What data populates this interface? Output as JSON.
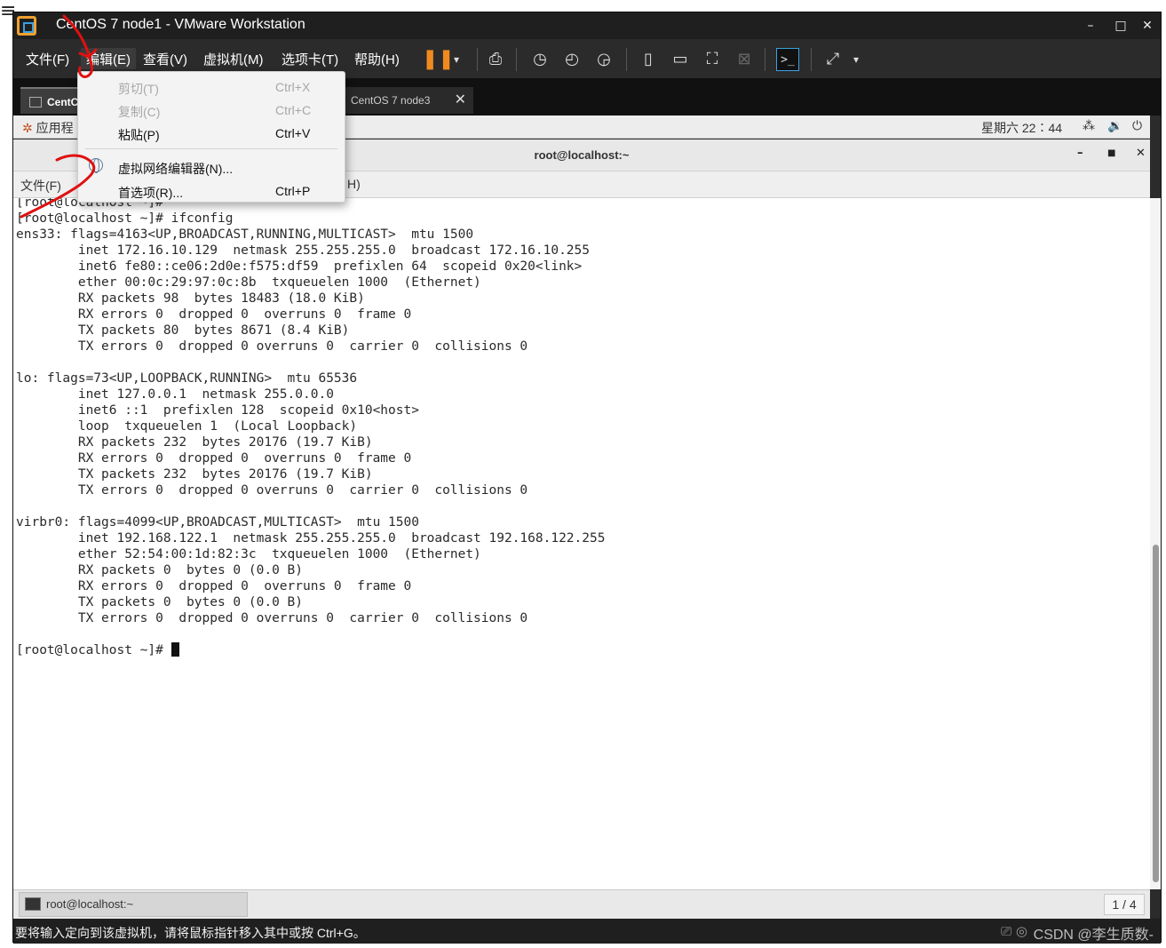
{
  "window": {
    "title": "CentOS 7 node1 - VMware Workstation",
    "controls": [
      "–",
      "□",
      "✕"
    ]
  },
  "menubar": {
    "items": [
      "文件(F)",
      "编辑(E)",
      "查看(V)",
      "虚拟机(M)",
      "选项卡(T)",
      "帮助(H)"
    ]
  },
  "toolbar_icons": [
    "pause-icon",
    "send-keys-icon",
    "snapshot-icon",
    "revert-snapshot-icon",
    "snapshot-manager-icon",
    "sidebar-icon",
    "thumbnail-bar-icon",
    "fullscreen-icon",
    "unity-icon",
    "console-icon",
    "stretch-icon"
  ],
  "tabs": [
    {
      "label": "CentOS 7 node1",
      "visible_label": "CentC",
      "active": true
    },
    {
      "label": "CentOS 7 node3",
      "active": false
    }
  ],
  "edit_menu": {
    "items": [
      {
        "label": "剪切(T)",
        "shortcut": "Ctrl+X",
        "enabled": false
      },
      {
        "label": "复制(C)",
        "shortcut": "Ctrl+C",
        "enabled": false
      },
      {
        "label": "粘贴(P)",
        "shortcut": "Ctrl+V",
        "enabled": true
      },
      {
        "label": "虚拟网络编辑器(N)...",
        "shortcut": "",
        "enabled": true
      },
      {
        "label": "首选项(R)...",
        "shortcut": "Ctrl+P",
        "enabled": true
      }
    ]
  },
  "guest_topbar": {
    "apps_label": "应用程",
    "clock": "星期六 22∶44",
    "icons": [
      "network-icon",
      "volume-icon",
      "power-icon"
    ]
  },
  "terminal": {
    "title": "root@localhost:~",
    "menu_first": "文件(F)",
    "menu_last": "H)",
    "lines": [
      "[root@localhost ~]# ",
      "[root@localhost ~]# ifconfig",
      "ens33: flags=4163<UP,BROADCAST,RUNNING,MULTICAST>  mtu 1500",
      "        inet 172.16.10.129  netmask 255.255.255.0  broadcast 172.16.10.255",
      "        inet6 fe80::ce06:2d0e:f575:df59  prefixlen 64  scopeid 0x20<link>",
      "        ether 00:0c:29:97:0c:8b  txqueuelen 1000  (Ethernet)",
      "        RX packets 98  bytes 18483 (18.0 KiB)",
      "        RX errors 0  dropped 0  overruns 0  frame 0",
      "        TX packets 80  bytes 8671 (8.4 KiB)",
      "        TX errors 0  dropped 0 overruns 0  carrier 0  collisions 0",
      "",
      "lo: flags=73<UP,LOOPBACK,RUNNING>  mtu 65536",
      "        inet 127.0.0.1  netmask 255.0.0.0",
      "        inet6 ::1  prefixlen 128  scopeid 0x10<host>",
      "        loop  txqueuelen 1  (Local Loopback)",
      "        RX packets 232  bytes 20176 (19.7 KiB)",
      "        RX errors 0  dropped 0  overruns 0  frame 0",
      "        TX packets 232  bytes 20176 (19.7 KiB)",
      "        TX errors 0  dropped 0 overruns 0  carrier 0  collisions 0",
      "",
      "virbr0: flags=4099<UP,BROADCAST,MULTICAST>  mtu 1500",
      "        inet 192.168.122.1  netmask 255.255.255.0  broadcast 192.168.122.255",
      "        ether 52:54:00:1d:82:3c  txqueuelen 1000  (Ethernet)",
      "        RX packets 0  bytes 0 (0.0 B)",
      "        RX errors 0  dropped 0  overruns 0  frame 0",
      "        TX packets 0  bytes 0 (0.0 B)",
      "        TX errors 0  dropped 0 overruns 0  carrier 0  collisions 0",
      "",
      "[root@localhost ~]# "
    ]
  },
  "taskbar": {
    "task_label": "root@localhost:~",
    "workspace": "1 / 4"
  },
  "statusbar": {
    "message": "要将输入定向到该虚拟机，请将鼠标指针移入其中或按 Ctrl+G。",
    "watermark": "CSDN @李生质数-"
  },
  "colors": {
    "vm_chrome": "#2b2b2b",
    "pause_accent": "#f08a20",
    "annotation_red": "#e01010"
  }
}
